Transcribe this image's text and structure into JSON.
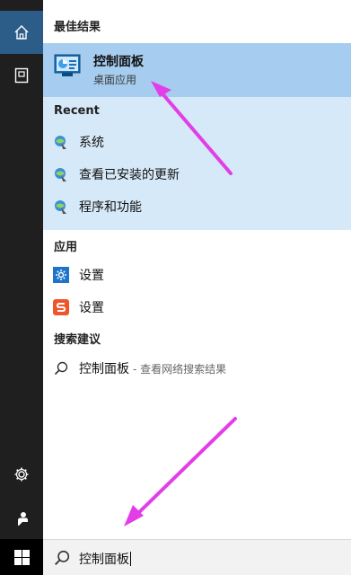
{
  "sidebar": {
    "items": [
      {
        "name": "home",
        "icon": "home-icon"
      },
      {
        "name": "documents",
        "icon": "document-icon"
      },
      {
        "name": "settings",
        "icon": "gear-icon"
      },
      {
        "name": "feedback",
        "icon": "feedback-icon"
      },
      {
        "name": "start",
        "icon": "windows-logo-icon"
      }
    ]
  },
  "best_match": {
    "header": "最佳结果",
    "title": "控制面板",
    "subtitle": "桌面应用",
    "icon": "control-panel-icon"
  },
  "recent": {
    "header": "Recent",
    "items": [
      {
        "label": "系统",
        "icon": "control-panel-applet-icon"
      },
      {
        "label": "查看已安装的更新",
        "icon": "control-panel-applet-icon"
      },
      {
        "label": "程序和功能",
        "icon": "control-panel-applet-icon"
      }
    ]
  },
  "apps": {
    "header": "应用",
    "items": [
      {
        "label": "设置",
        "icon": "settings-gear-icon"
      },
      {
        "label": "设置",
        "icon": "sogou-s-icon"
      }
    ]
  },
  "suggestions": {
    "header": "搜索建议",
    "items": [
      {
        "label": "控制面板",
        "hint": "- 查看网络搜索结果",
        "icon": "search-icon"
      }
    ]
  },
  "search": {
    "value": "控制面板",
    "icon": "search-icon"
  },
  "colors": {
    "rail": "#1f1f1f",
    "home_active": "#2b5d88",
    "best_highlight": "#a6cdf0",
    "recent_bg": "#d6e9f8",
    "annotation_arrow": "#e23ee8"
  }
}
